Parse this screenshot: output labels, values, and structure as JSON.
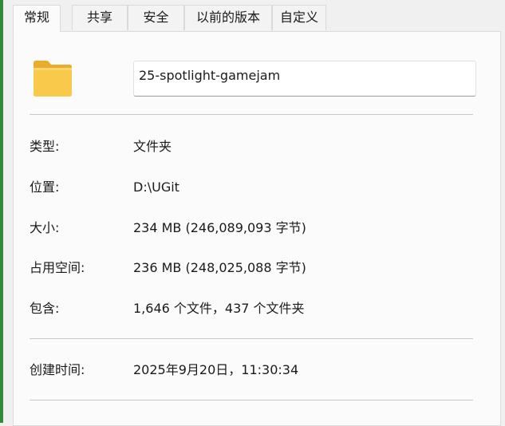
{
  "tabs": [
    {
      "label": "常规",
      "active": true
    },
    {
      "label": "共享",
      "active": false
    },
    {
      "label": "安全",
      "active": false
    },
    {
      "label": "以前的版本",
      "active": false
    },
    {
      "label": "自定义",
      "active": false
    }
  ],
  "folder": {
    "icon": "folder-icon",
    "name": "25-spotlight-gamejam",
    "icon_color": "#f8c94a"
  },
  "properties": {
    "type": {
      "label": "类型:",
      "value": "文件夹"
    },
    "location": {
      "label": "位置:",
      "value": "D:\\UGit"
    },
    "size": {
      "label": "大小:",
      "value": "234 MB (246,089,093 字节)"
    },
    "size_on_disk": {
      "label": "占用空间:",
      "value": "236 MB (248,025,088 字节)"
    },
    "contains": {
      "label": "包含:",
      "value": "1,646 个文件，437 个文件夹"
    },
    "created": {
      "label": "创建时间:",
      "value": "2025年9月20日，11:30:34"
    }
  },
  "colors": {
    "window_edge": "#2e8b3e",
    "panel_background": "#fbfbfb",
    "divider": "#c9c9c9"
  }
}
